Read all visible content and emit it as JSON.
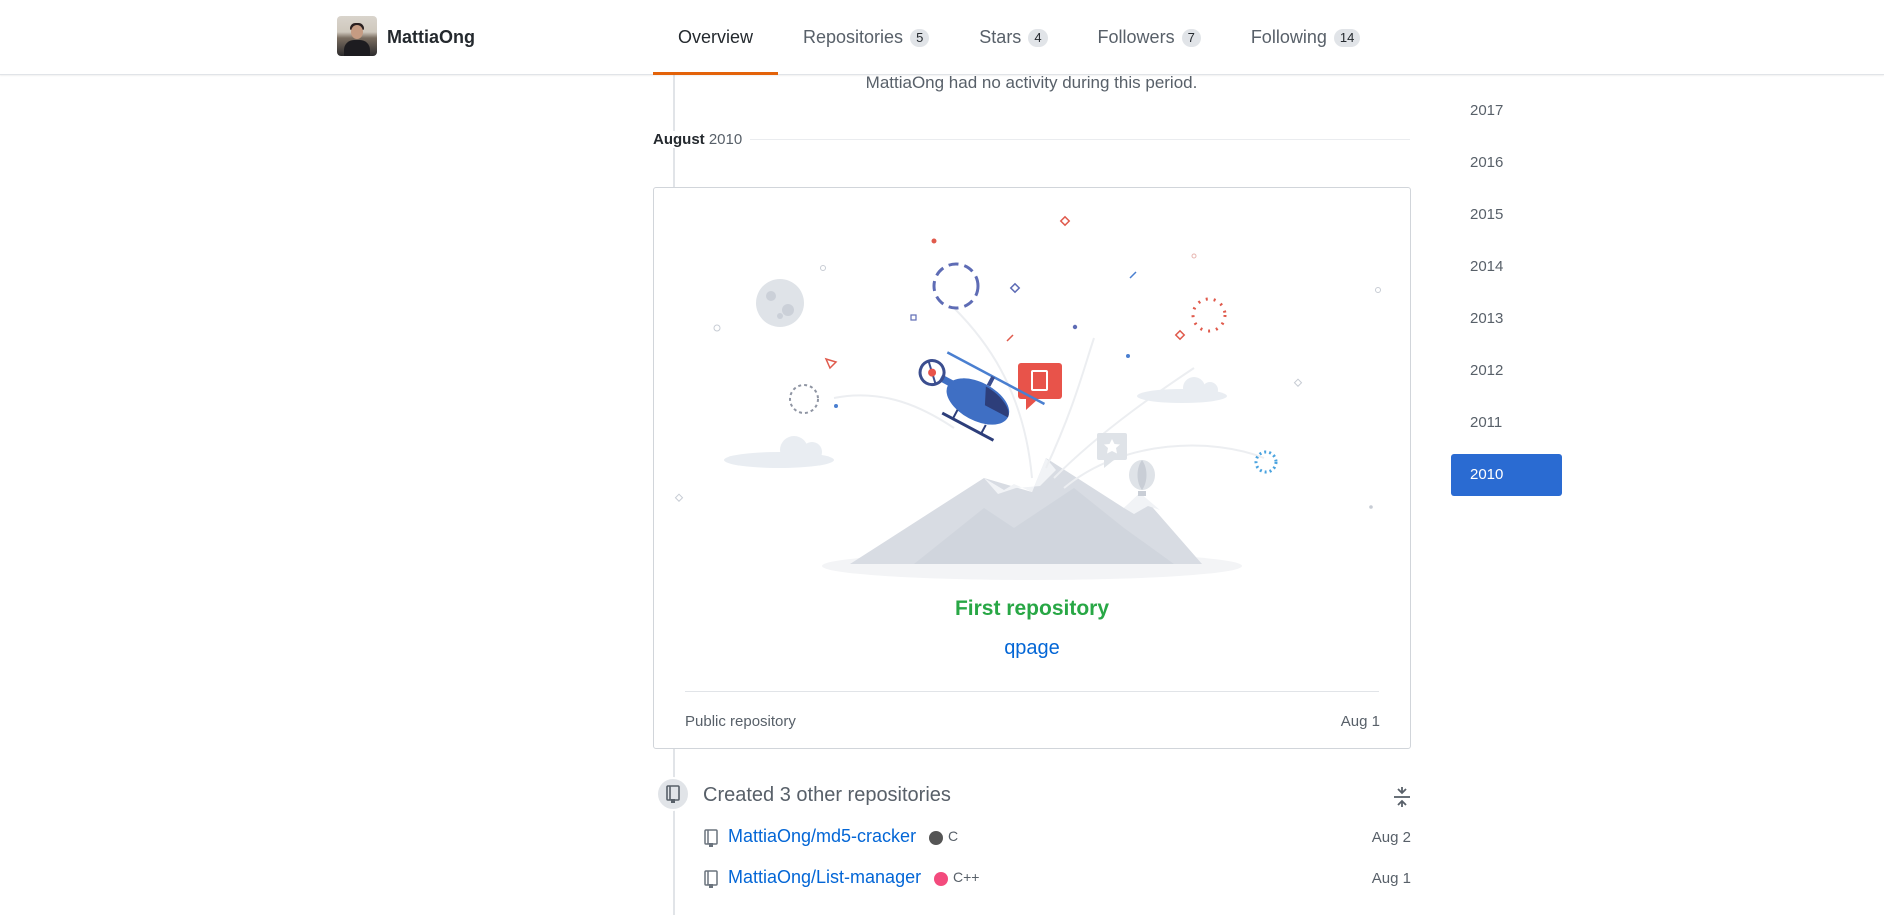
{
  "profile": {
    "username": "MattiaOng"
  },
  "tabs": [
    {
      "label": "Overview",
      "count": null,
      "selected": true
    },
    {
      "label": "Repositories",
      "count": "5"
    },
    {
      "label": "Stars",
      "count": "4"
    },
    {
      "label": "Followers",
      "count": "7"
    },
    {
      "label": "Following",
      "count": "14"
    }
  ],
  "timeline": {
    "no_activity": "MattiaOng had no activity during this period.",
    "month": "August",
    "year": "2010",
    "first_repo_card": {
      "title": "First repository",
      "repo_name": "qpage",
      "visibility": "Public repository",
      "date": "Aug 1"
    },
    "created_group": {
      "title": "Created 3 other repositories",
      "repos": [
        {
          "name": "MattiaOng/md5-cracker",
          "language": "C",
          "lang_color": "#555555",
          "date": "Aug 2"
        },
        {
          "name": "MattiaOng/List-manager",
          "language": "C++",
          "lang_color": "#f34b7d",
          "date": "Aug 1"
        }
      ]
    }
  },
  "years": [
    "2017",
    "2016",
    "2015",
    "2014",
    "2013",
    "2012",
    "2011",
    "2010"
  ],
  "selected_year": "2010",
  "colors": {
    "accent_orange": "#e36209",
    "link_blue": "#0366d6",
    "success_green": "#28a745",
    "year_selected": "#2a6bd2"
  }
}
